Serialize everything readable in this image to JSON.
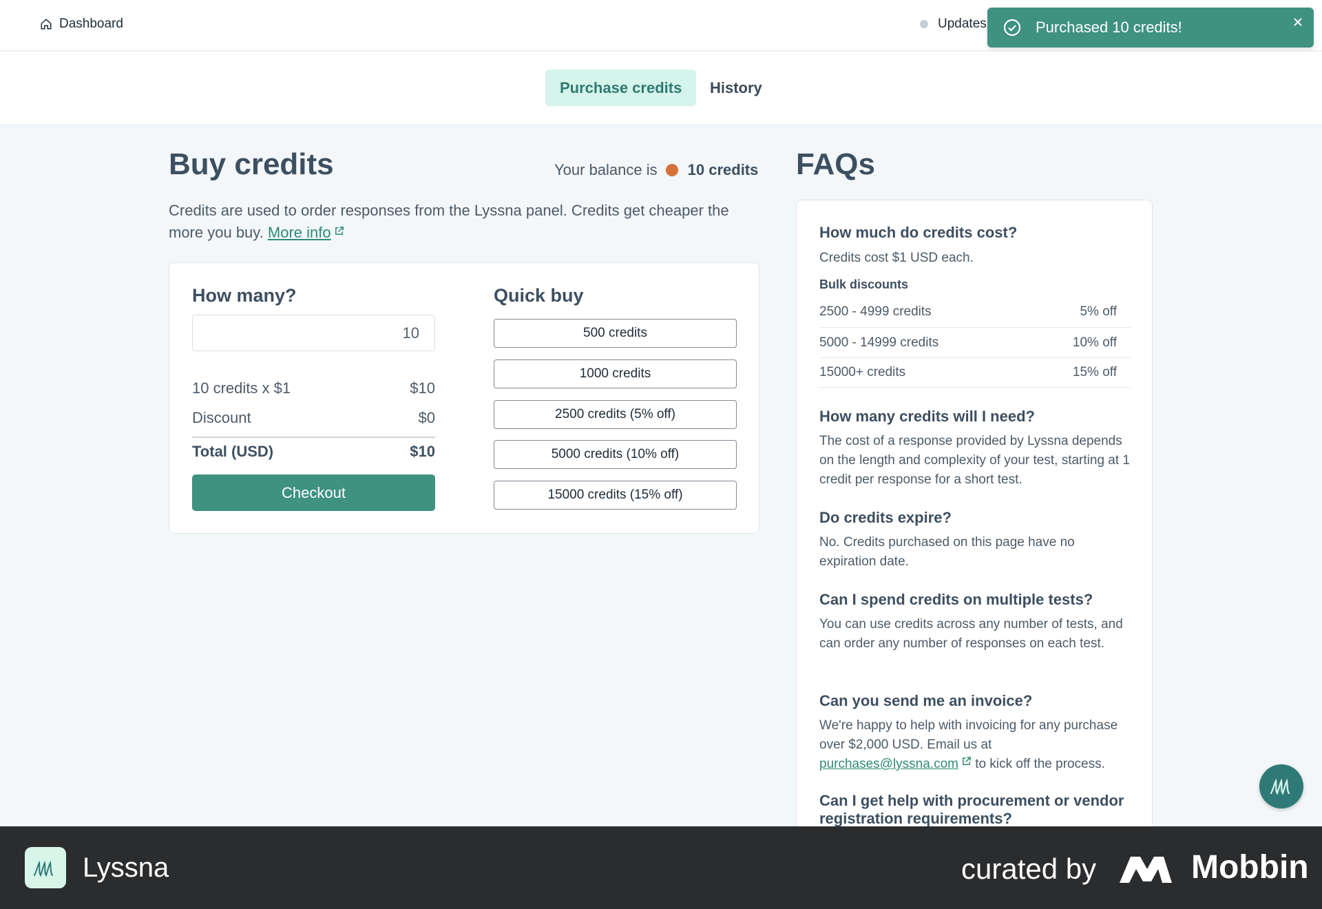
{
  "header": {
    "dashboard_label": "Dashboard",
    "updates_label": "Updates"
  },
  "toast": {
    "message": "Purchased 10 credits!"
  },
  "tabs": [
    {
      "label": "Purchase credits",
      "active": true
    },
    {
      "label": "History",
      "active": false
    }
  ],
  "buy": {
    "title": "Buy credits",
    "balance_prefix": "Your balance is",
    "balance_value": "10 credits",
    "description": "Credits are used to order responses from the Lyssna panel. Credits get cheaper the more you buy.",
    "more_info": "More info",
    "how_many_title": "How many?",
    "quantity": "10",
    "line_label": "10 credits x $1",
    "line_value": "$10",
    "discount_label": "Discount",
    "discount_value": "$0",
    "total_label": "Total (USD)",
    "total_value": "$10",
    "checkout_label": "Checkout",
    "quick_buy_title": "Quick buy",
    "quick_buy": [
      "500 credits",
      "1000 credits",
      "2500 credits (5% off)",
      "5000 credits (10% off)",
      "15000 credits (15% off)"
    ]
  },
  "faq": {
    "title": "FAQs",
    "q1": "How much do credits cost?",
    "a1": "Credits cost $1 USD each.",
    "bulk_title": "Bulk discounts",
    "bulk": [
      {
        "range": "2500 - 4999 credits",
        "discount": "5% off"
      },
      {
        "range": "5000 - 14999 credits",
        "discount": "10% off"
      },
      {
        "range": "15000+ credits",
        "discount": "15% off"
      }
    ],
    "q2": "How many credits will I need?",
    "a2": "The cost of a response provided by Lyssna depends on the length and complexity of your test, starting at 1 credit per response for a short test.",
    "q3": "Do credits expire?",
    "a3": "No. Credits purchased on this page have no expiration date.",
    "q4": "Can I spend credits on multiple tests?",
    "a4": "You can use credits across any number of tests, and can order any number of responses on each test.",
    "q5": "Can you send me an invoice?",
    "a5_pre": "We're happy to help with invoicing for any purchase over $2,000 USD. Email us at",
    "a5_email": "purchases@lyssna.com",
    "a5_post": "to kick off the process.",
    "q6": "Can I get help with procurement or vendor registration requirements?"
  },
  "footer": {
    "brand": "Lyssna",
    "curated": "curated by",
    "mobbin": "Mobbin"
  },
  "colors": {
    "accent": "#3f9280",
    "tab_active_bg": "#d5f4ec",
    "coin": "#d3733a",
    "footer_bg": "#2b2c2e"
  },
  "icons": [
    "home-icon",
    "check-circle-icon",
    "close-icon",
    "external-link-icon",
    "chat-icon",
    "lyssna-logo-icon",
    "mobbin-logo-icon"
  ]
}
